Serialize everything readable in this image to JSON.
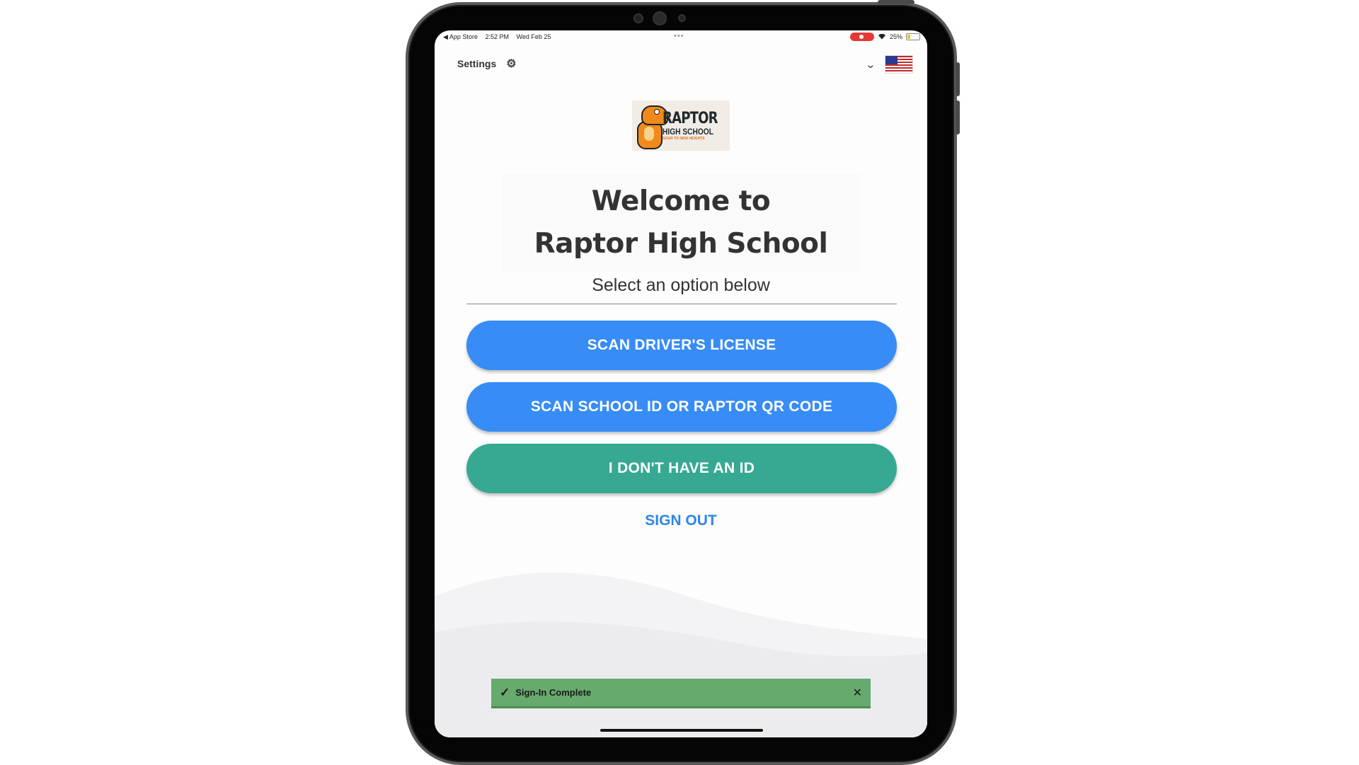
{
  "status_bar": {
    "back_app": "◀ App Store",
    "time": "2:52 PM",
    "date": "Wed Feb 25",
    "dots": "•••",
    "battery": "25%"
  },
  "header": {
    "settings_label": "Settings",
    "settings_icon": "gear-icon",
    "language_icon": "us-flag-icon"
  },
  "logo": {
    "line1": "RAPTOR",
    "line2": "HIGH SCHOOL",
    "tagline": "SOAR TO NEW HEIGHTS"
  },
  "welcome": {
    "line1": "Welcome to",
    "line2": "Raptor High School",
    "subtitle": "Select an option below"
  },
  "buttons": {
    "scan_license": "SCAN DRIVER'S LICENSE",
    "scan_school_id": "SCAN SCHOOL ID OR RAPTOR QR CODE",
    "no_id": "I DON'T HAVE AN ID",
    "sign_out": "SIGN OUT"
  },
  "toast": {
    "message": "Sign-In Complete"
  },
  "colors": {
    "primary_blue": "#378cf5",
    "green": "#37a892",
    "link_blue": "#2f86e6",
    "toast_green": "#67aa6d"
  }
}
